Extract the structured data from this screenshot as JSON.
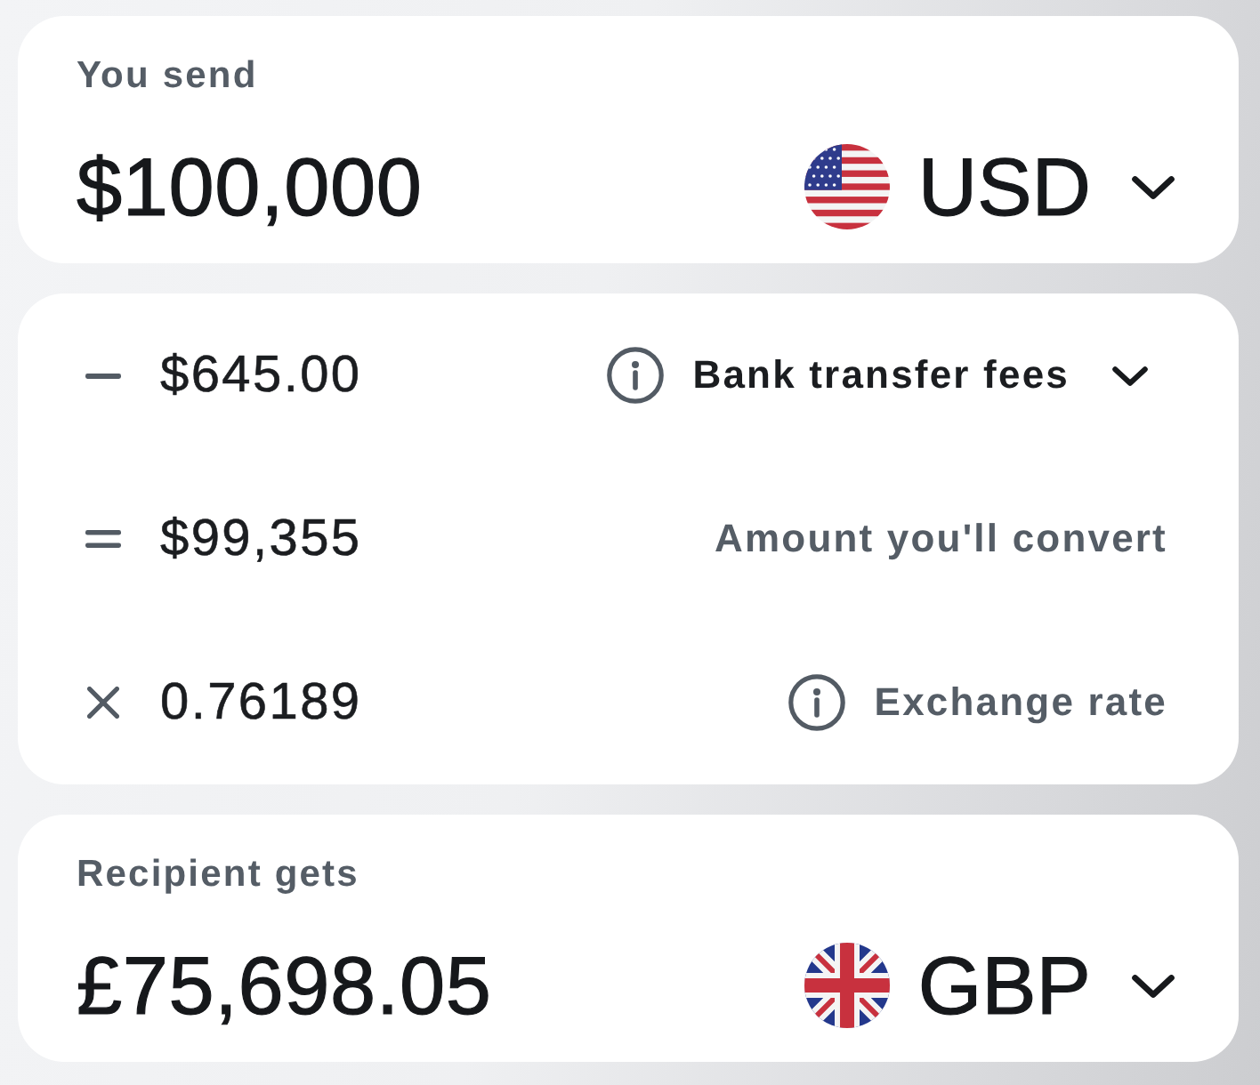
{
  "send": {
    "label": "You send",
    "amount": "$100,000",
    "currency": {
      "code": "USD",
      "kind": "us"
    }
  },
  "breakdown": [
    {
      "kind": "minus",
      "amount": "$645.00",
      "label": "Bank transfer fees",
      "info": true,
      "expandable": true
    },
    {
      "kind": "equals",
      "amount": "$99,355",
      "label": "Amount you'll convert",
      "info": false,
      "expandable": false
    },
    {
      "kind": "times",
      "amount": "0.76189",
      "label": "Exchange rate",
      "info": true,
      "expandable": false
    }
  ],
  "receive": {
    "label": "Recipient gets",
    "amount": "£75,698.05",
    "currency": {
      "code": "GBP",
      "kind": "gb"
    }
  }
}
